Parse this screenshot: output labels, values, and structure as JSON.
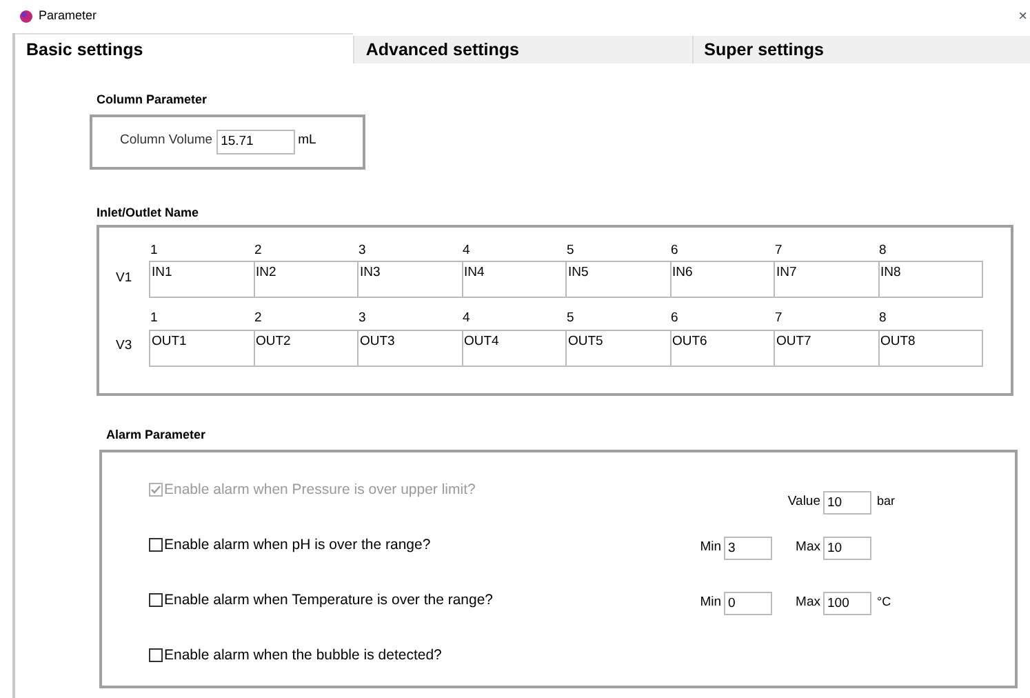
{
  "window": {
    "title": "Parameter",
    "close": "×"
  },
  "tabs": [
    {
      "label": "Basic settings",
      "selected": true
    },
    {
      "label": "Advanced settings",
      "selected": false
    },
    {
      "label": "Super settings",
      "selected": false
    }
  ],
  "column_parameter": {
    "title": "Column Parameter",
    "label": "Column Volume",
    "value": "15.71",
    "unit": "mL"
  },
  "inlet_outlet": {
    "title": "Inlet/Outlet Name",
    "rows": [
      {
        "valve": "V1",
        "ports": [
          {
            "number": "1",
            "name": "IN1"
          },
          {
            "number": "2",
            "name": "IN2"
          },
          {
            "number": "3",
            "name": "IN3"
          },
          {
            "number": "4",
            "name": "IN4"
          },
          {
            "number": "5",
            "name": "IN5"
          },
          {
            "number": "6",
            "name": "IN6"
          },
          {
            "number": "7",
            "name": "IN7"
          },
          {
            "number": "8",
            "name": "IN8"
          }
        ]
      },
      {
        "valve": "V3",
        "ports": [
          {
            "number": "1",
            "name": "OUT1"
          },
          {
            "number": "2",
            "name": "OUT2"
          },
          {
            "number": "3",
            "name": "OUT3"
          },
          {
            "number": "4",
            "name": "OUT4"
          },
          {
            "number": "5",
            "name": "OUT5"
          },
          {
            "number": "6",
            "name": "OUT6"
          },
          {
            "number": "7",
            "name": "OUT7"
          },
          {
            "number": "8",
            "name": "OUT8"
          }
        ]
      }
    ]
  },
  "alarm_parameter": {
    "title": "Alarm Parameter",
    "alarms": [
      {
        "label": "Enable alarm when Pressure is over upper limit?",
        "checked": true,
        "disabled": true,
        "fields": [
          {
            "label": "Value",
            "value": "10"
          }
        ],
        "unit": "bar"
      },
      {
        "label": "Enable alarm when pH is over the range?",
        "checked": false,
        "disabled": false,
        "fields": [
          {
            "label": "Min",
            "value": "3"
          },
          {
            "label": "Max",
            "value": "10"
          }
        ]
      },
      {
        "label": "Enable alarm when Temperature is over the range?",
        "checked": false,
        "disabled": false,
        "fields": [
          {
            "label": "Min",
            "value": "0"
          },
          {
            "label": "Max",
            "value": "100"
          }
        ],
        "unit": "°C"
      },
      {
        "label": "Enable alarm when the bubble is detected?",
        "checked": false,
        "disabled": false
      }
    ]
  }
}
